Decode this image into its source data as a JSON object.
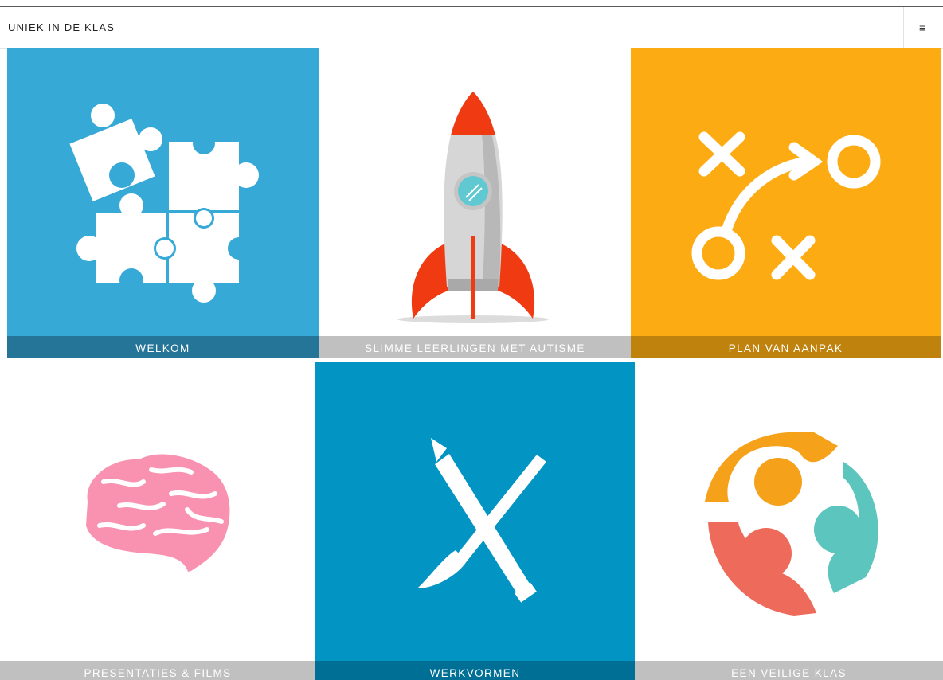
{
  "header": {
    "site_title": "UNIEK IN DE KLAS",
    "menu_icon": "≡"
  },
  "tiles": [
    {
      "label": "WELKOM",
      "icon": "puzzle-icon",
      "color": "#36a9d7"
    },
    {
      "label": "SLIMME LEERLINGEN MET AUTISME",
      "icon": "rocket-icon",
      "color": "#ffffff"
    },
    {
      "label": "PLAN VAN AANPAK",
      "icon": "strategy-icon",
      "color": "#fdab13"
    },
    {
      "label": "PRESENTATIES & FILMS",
      "icon": "brain-icon",
      "color": "#ffffff"
    },
    {
      "label": "WERKVORMEN",
      "icon": "pencil-brush-icon",
      "color": "#0294c3"
    },
    {
      "label": "EEN VEILIGE KLAS",
      "icon": "team-circle-icon",
      "color": "#ffffff"
    }
  ]
}
